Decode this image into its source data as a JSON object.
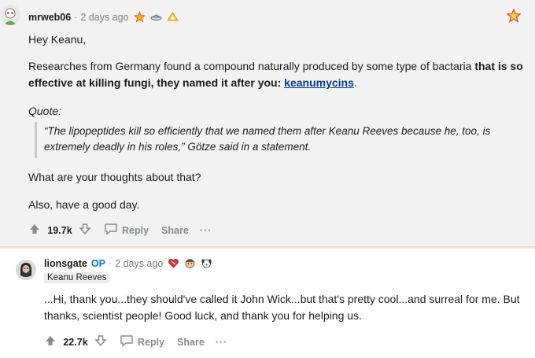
{
  "comment": {
    "username": "mrweb06",
    "dot": "·",
    "time": "2 days ago",
    "award_icons": [
      "star-award-icon",
      "ufo-award-icon",
      "silver-award-icon"
    ],
    "greeting": "Hey Keanu,",
    "para1_start": "Researches from Germany found a compound naturally produced by some type of bactaria ",
    "para1_bold": "that is so effective at killing fungi, they named it after you: ",
    "para1_link": "keanumycins",
    "para1_end": ".",
    "quote_label": "Quote:",
    "quote_text": "“The lipopeptides kill so efficiently that we named them after Keanu Reeves because he, too, is extremely deadly in his roles,” Götze said in a statement.",
    "question": "What are your thoughts about that?",
    "closing": "Also, have a good day.",
    "votes": "19.7k",
    "reply_label": "Reply",
    "share_label": "Share",
    "more_label": "···"
  },
  "reply": {
    "username": "lionsgate",
    "op_badge": "OP",
    "dot": "·",
    "time": "2 days ago",
    "award_icons": [
      "heart-award-icon",
      "face-award-icon",
      "dog-award-icon"
    ],
    "flair": "Keanu Reeves",
    "text": "...Hi, thank you...they should've called it John Wick...but that's pretty cool...and surreal for me. But thanks, scientist people! Good luck, and thank you for helping us.",
    "votes": "22.7k",
    "reply_label": "Reply",
    "share_label": "Share",
    "more_label": "···"
  },
  "colors": {
    "background_highlight": "#f2f2f3",
    "link": "#0b3a8a",
    "op": "#0079d3",
    "muted": "#878a8c"
  }
}
